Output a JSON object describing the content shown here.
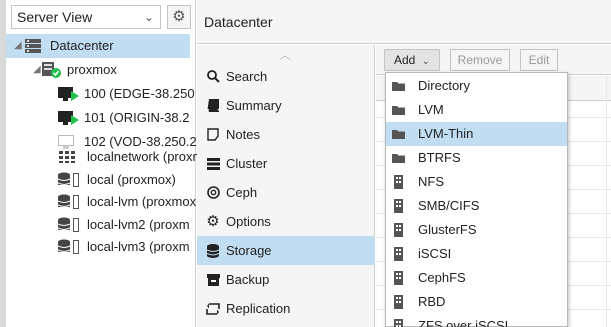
{
  "left": {
    "view_selector": "Server View",
    "tree": [
      {
        "label": "Datacenter",
        "icon": "server-rack-icon",
        "selected": true
      },
      {
        "label": "proxmox",
        "icon": "node-online-icon"
      },
      {
        "label": "100 (EDGE-38.250",
        "icon": "vm-running-icon"
      },
      {
        "label": "101 (ORIGIN-38.2",
        "icon": "vm-running-icon"
      },
      {
        "label": "102 (VOD-38.250.2",
        "icon": "vm-stopped-icon"
      },
      {
        "label": "localnetwork (proxm",
        "icon": "grid-icon"
      },
      {
        "label": "local (proxmox)",
        "icon": "storage-icon"
      },
      {
        "label": "local-lvm (proxmox",
        "icon": "storage-icon"
      },
      {
        "label": "local-lvm2 (proxm",
        "icon": "storage-icon"
      },
      {
        "label": "local-lvm3 (proxm",
        "icon": "storage-icon"
      }
    ]
  },
  "header": {
    "title": "Datacenter"
  },
  "nav": {
    "items": [
      {
        "label": "Search",
        "icon": "search-icon"
      },
      {
        "label": "Summary",
        "icon": "book-icon"
      },
      {
        "label": "Notes",
        "icon": "note-icon"
      },
      {
        "label": "Cluster",
        "icon": "cluster-icon"
      },
      {
        "label": "Ceph",
        "icon": "ceph-icon"
      },
      {
        "label": "Options",
        "icon": "gear-icon"
      },
      {
        "label": "Storage",
        "icon": "database-icon",
        "active": true
      },
      {
        "label": "Backup",
        "icon": "backup-icon"
      },
      {
        "label": "Replication",
        "icon": "replication-icon"
      }
    ]
  },
  "toolbar": {
    "add": "Add",
    "remove": "Remove",
    "edit": "Edit"
  },
  "add_menu": {
    "items": [
      {
        "label": "Directory",
        "icon": "folder-icon"
      },
      {
        "label": "LVM",
        "icon": "folder-icon"
      },
      {
        "label": "LVM-Thin",
        "icon": "folder-icon",
        "hover": true
      },
      {
        "label": "BTRFS",
        "icon": "folder-icon"
      },
      {
        "label": "NFS",
        "icon": "building-icon"
      },
      {
        "label": "SMB/CIFS",
        "icon": "building-icon"
      },
      {
        "label": "GlusterFS",
        "icon": "building-icon"
      },
      {
        "label": "iSCSI",
        "icon": "building-icon"
      },
      {
        "label": "CephFS",
        "icon": "building-icon"
      },
      {
        "label": "RBD",
        "icon": "building-icon"
      },
      {
        "label": "ZFS over iSCSI",
        "icon": "building-icon"
      }
    ]
  },
  "colors": {
    "selection": "#c1ddf1",
    "running": "#21bf4b",
    "panel": "#f5f5f5"
  }
}
